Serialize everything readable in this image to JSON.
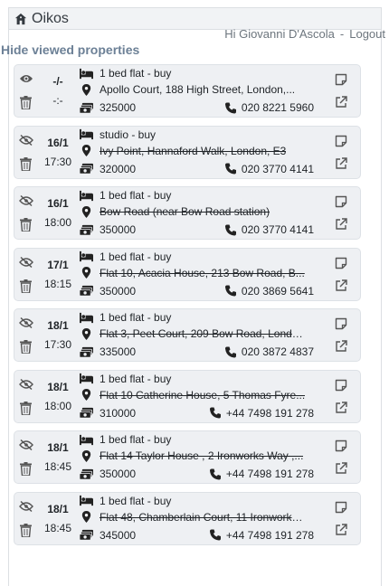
{
  "brand": {
    "title": "Oikos"
  },
  "user": {
    "greeting": "Hi Giovanni D'Ascola",
    "separator": "-",
    "logout": "Logout"
  },
  "actions": {
    "hide_viewed": "Hide viewed properties"
  },
  "properties": [
    {
      "date": "-/-",
      "time": "-:-",
      "type": "1 bed flat - buy",
      "address": "Apollo Court, 188 High Street, London,...",
      "price": "325000",
      "phone": "020 8221 5960",
      "viewed": false
    },
    {
      "date": "16/1",
      "time": "17:30",
      "type": "studio - buy",
      "address": "Ivy Point, Hannaford Walk, London, E3",
      "price": "320000",
      "phone": "020 3770 4141",
      "viewed": true
    },
    {
      "date": "16/1",
      "time": "18:00",
      "type": "1 bed flat - buy",
      "address": "Bow Road (near Bow Road station)",
      "price": "350000",
      "phone": "020 3770 4141",
      "viewed": true
    },
    {
      "date": "17/1",
      "time": "18:15",
      "type": "1 bed flat - buy",
      "address": "Flat 10, Acacia House, 213 Bow Road, B...",
      "price": "350000",
      "phone": "020 3869 5641",
      "viewed": true
    },
    {
      "date": "18/1",
      "time": "17:30",
      "type": "1 bed flat - buy",
      "address": "Flat 3, Peet Court, 209 Bow Road, Londo...",
      "price": "335000",
      "phone": "020 3872 4837",
      "viewed": true
    },
    {
      "date": "18/1",
      "time": "18:00",
      "type": "1 bed flat - buy",
      "address": "Flat 10 Catherine House, 5 Thomas Fyre...",
      "price": "310000",
      "phone": "+44 7498 191 278",
      "viewed": true
    },
    {
      "date": "18/1",
      "time": "18:45",
      "type": "1 bed flat - buy",
      "address": "Flat 14 Taylor House , 2 Ironworks Way ,...",
      "price": "350000",
      "phone": "+44 7498 191 278",
      "viewed": true
    },
    {
      "date": "18/1",
      "time": "18:45",
      "type": "1 bed flat - buy",
      "address": "Flat 48, Chamberlain Court, 11 Ironworks...",
      "price": "345000",
      "phone": "+44 7498 191 278",
      "viewed": true
    }
  ],
  "icons": {
    "home": "home-icon",
    "eye": "eye-icon",
    "eye_slash": "eye-slash-icon",
    "trash": "trash-icon",
    "bed": "bed-icon",
    "marker": "map-marker-icon",
    "money": "money-icon",
    "phone": "phone-icon",
    "note": "note-icon",
    "external": "external-link-icon"
  },
  "colors": {
    "link": "#6c8096",
    "card_bg": "#eef0f3",
    "icon": "#555555"
  }
}
